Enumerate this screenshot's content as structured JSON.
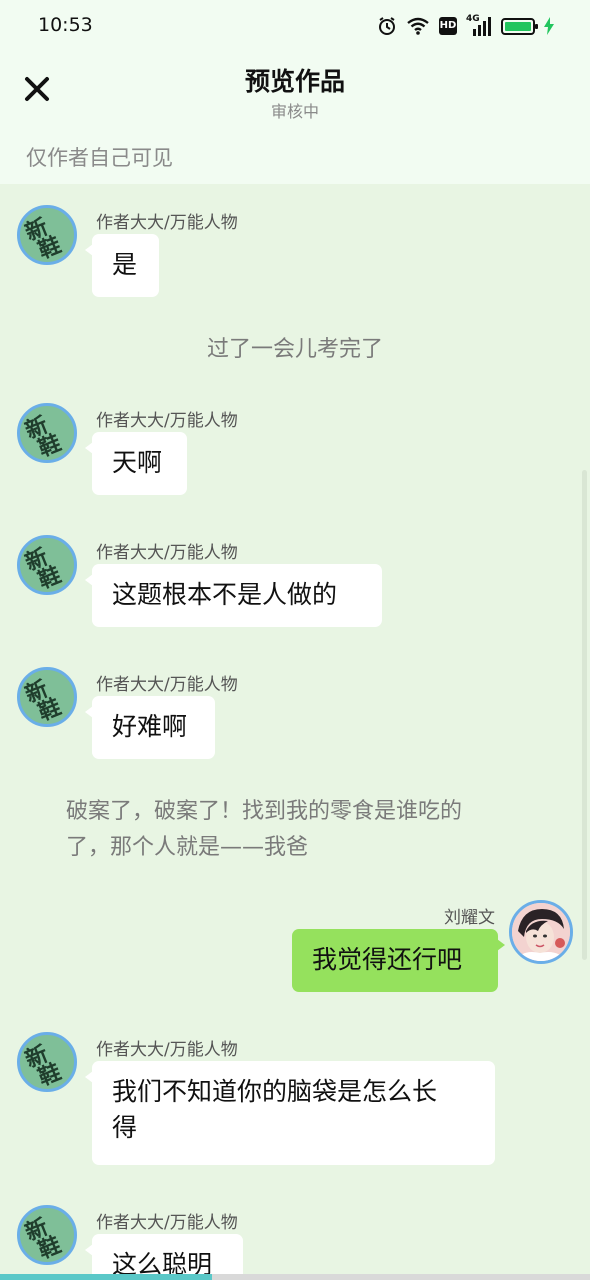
{
  "status": {
    "time": "10:53",
    "icons": [
      "alarm-icon",
      "wifi-icon",
      "hd-icon",
      "4g-signal-icon",
      "battery-icon",
      "charging-icon"
    ],
    "hd_label": "HD",
    "net_label": "4G"
  },
  "header": {
    "close_icon": "close-icon",
    "title": "预览作品",
    "subtitle": "审核中",
    "visibility_note": "仅作者自己可见"
  },
  "messages": [
    {
      "type": "bubble",
      "side": "left",
      "name": "作者大大/万能人物",
      "text": "是",
      "avatar_text": [
        "新",
        "鞋"
      ]
    },
    {
      "type": "narration",
      "text": "过了一会儿考完了"
    },
    {
      "type": "bubble",
      "side": "left",
      "name": "作者大大/万能人物",
      "text": "天啊",
      "avatar_text": [
        "新",
        "鞋"
      ]
    },
    {
      "type": "bubble",
      "side": "left",
      "name": "作者大大/万能人物",
      "text": "这题根本不是人做的",
      "avatar_text": [
        "新",
        "鞋"
      ]
    },
    {
      "type": "bubble",
      "side": "left",
      "name": "作者大大/万能人物",
      "text": "好难啊",
      "avatar_text": [
        "新",
        "鞋"
      ]
    },
    {
      "type": "narration",
      "text_lines": [
        "破案了，破案了！找到我的零食是谁吃的",
        "了，那个人就是——我爸"
      ]
    },
    {
      "type": "bubble",
      "side": "right",
      "name": "刘耀文",
      "text": "我觉得还行吧"
    },
    {
      "type": "bubble",
      "side": "left",
      "name": "作者大大/万能人物",
      "text_lines": [
        "我们不知道你的脑袋是怎么长",
        "得"
      ],
      "avatar_text": [
        "新",
        "鞋"
      ]
    },
    {
      "type": "bubble",
      "side": "left",
      "name": "作者大大/万能人物",
      "text": "这么聪明",
      "avatar_text": [
        "新",
        "鞋"
      ]
    }
  ],
  "colors": {
    "background": "#e8f5e3",
    "header_bg": "#f2fcf2",
    "my_bubble": "#95e15d",
    "other_bubble": "#ffffff",
    "avatar_ring": "#6aaee8",
    "progress": "#5ac8c8"
  },
  "reading_progress": 0.36
}
